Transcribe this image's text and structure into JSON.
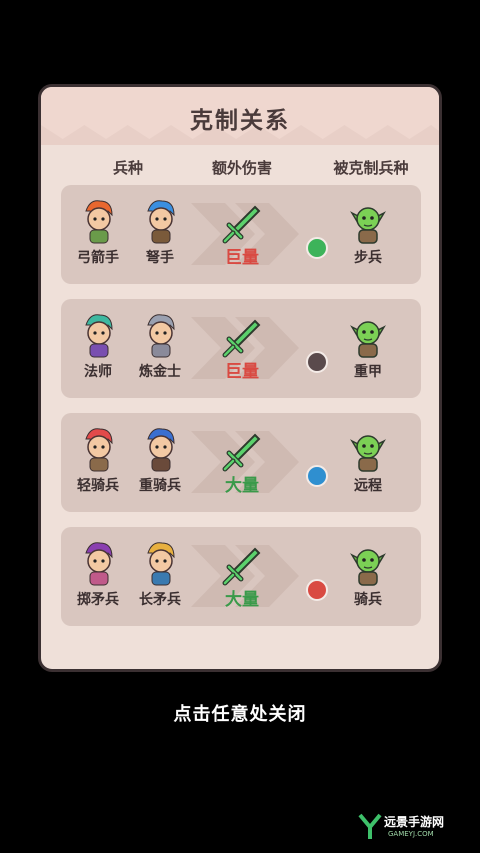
{
  "title": "克制关系",
  "columns": [
    "兵种",
    "额外伤害",
    "被克制兵种"
  ],
  "rows": [
    {
      "units": [
        "弓箭手",
        "弩手"
      ],
      "damage": "巨量",
      "damage_color": "#d94a42",
      "badge_color": "#3db35a",
      "badge_icon": "boot-icon",
      "enemy": "步兵"
    },
    {
      "units": [
        "法师",
        "炼金士"
      ],
      "damage": "巨量",
      "damage_color": "#d94a42",
      "badge_color": "#5a4a4c",
      "badge_icon": "helmet-icon",
      "enemy": "重甲"
    },
    {
      "units": [
        "轻骑兵",
        "重骑兵"
      ],
      "damage": "大量",
      "damage_color": "#3a9a4a",
      "badge_color": "#2f8fd0",
      "badge_icon": "bow-icon",
      "enemy": "远程"
    },
    {
      "units": [
        "掷矛兵",
        "长矛兵"
      ],
      "damage": "大量",
      "damage_color": "#3a9a4a",
      "badge_color": "#d94a42",
      "badge_icon": "horse-icon",
      "enemy": "骑兵"
    }
  ],
  "footer": "点击任意处关闭",
  "watermark": {
    "text": "远景手游网",
    "sub": "GAMEYJ.COM"
  }
}
